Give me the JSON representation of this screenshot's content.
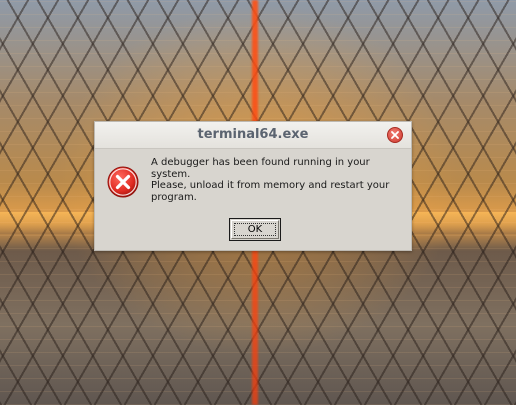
{
  "dialog": {
    "title": "terminal64.exe",
    "message_line1": "A debugger has been found running in your system.",
    "message_line2": "Please, unload it from memory and restart your program.",
    "ok_label": "OK",
    "icon": "error-icon",
    "close_icon": "close-icon"
  },
  "colors": {
    "error_red": "#e02b22",
    "close_red": "#cf3a2f",
    "title_text": "#5b6470",
    "dialog_bg": "#d8d5cf"
  }
}
